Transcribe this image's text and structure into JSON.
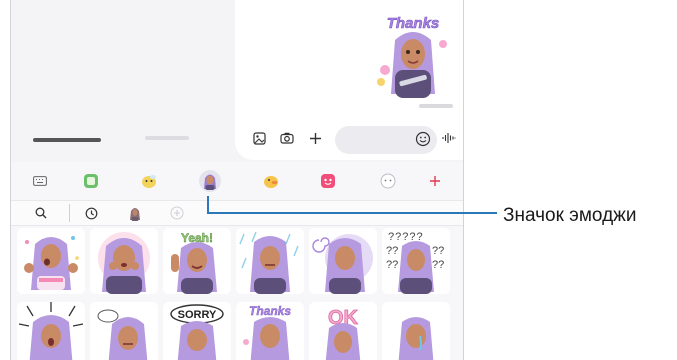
{
  "conversation": {
    "tabs": [
      "",
      ""
    ],
    "sent_sticker": {
      "caption": "Thanks"
    }
  },
  "toolbar": {
    "icons": [
      "gallery-icon",
      "camera-icon",
      "plus-icon",
      "emoji-icon",
      "voice-icon"
    ]
  },
  "emoji_panel": {
    "categories": [
      "keyboard-icon",
      "sticker-pack-green",
      "sticker-pack-bee",
      "ar-emoji",
      "sticker-pack-duck",
      "sticker-pack-red",
      "sticker-pack-cloud",
      "add-icon"
    ],
    "subcategories": [
      "search-icon",
      "recent-icon",
      "avatar-icon",
      "add-icon"
    ],
    "stickers_row1": [
      "birthday",
      "surprise",
      "Yeah!",
      "rain",
      "dizzy",
      "??? ??? ???"
    ],
    "stickers_row2": [
      "shocked",
      "sigh",
      "SORRY",
      "Thanks",
      "OK",
      "tears"
    ]
  },
  "callout": {
    "label": "Значок эмоджи"
  },
  "colors": {
    "accent": "#2a77b9",
    "hair": "#b59ae0",
    "add": "#e23a4f"
  }
}
